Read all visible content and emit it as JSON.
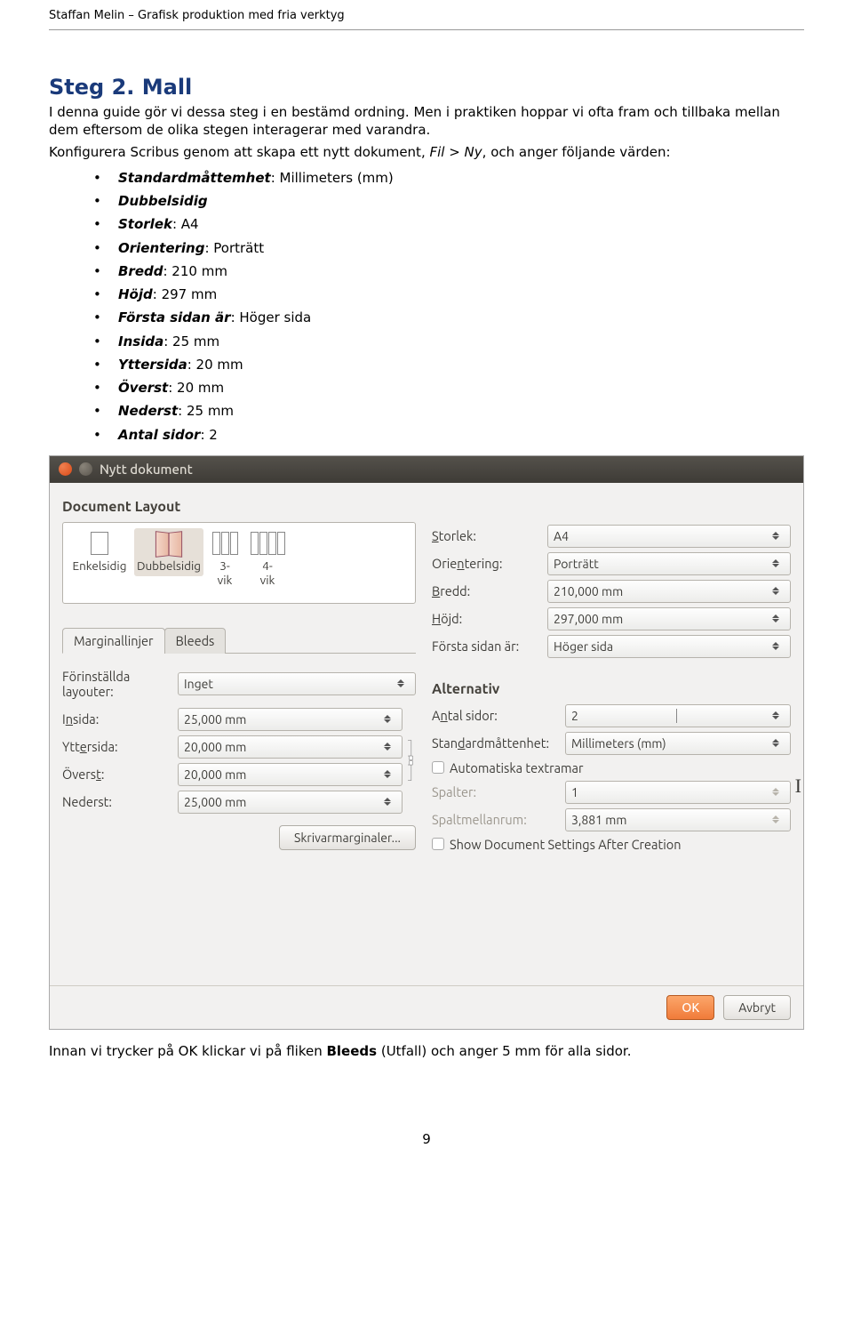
{
  "doc_header": "Staffan Melin – Grafisk produktion med fria verktyg",
  "title": "Steg 2. Mall",
  "para1": "I denna guide gör vi dessa steg i en bestämd ordning. Men i praktiken hoppar vi ofta fram och tillbaka mellan dem eftersom de olika stegen interagerar med varandra.",
  "para2_a": "Konfigurera Scribus genom att skapa ett nytt dokument, ",
  "para2_b": "Fil > Ny",
  "para2_c": ", och anger följande värden:",
  "bullets": [
    {
      "k": "Standardmåttemhet",
      "v": ": Millimeters (mm)"
    },
    {
      "k": "Dubbelsidig",
      "v": ""
    },
    {
      "k": "Storlek",
      "v": ": A4"
    },
    {
      "k": "Orientering",
      "v": ": Porträtt"
    },
    {
      "k": "Bredd",
      "v": ": 210 mm"
    },
    {
      "k": "Höjd",
      "v": ": 297 mm"
    },
    {
      "k": "Första sidan är",
      "v": ": Höger sida"
    },
    {
      "k": "Insida",
      "v": ": 25 mm"
    },
    {
      "k": "Yttersida",
      "v": ": 20 mm"
    },
    {
      "k": "Överst",
      "v": ": 20 mm"
    },
    {
      "k": "Nederst",
      "v": ": 25 mm"
    },
    {
      "k": "Antal sidor",
      "v": ": 2"
    }
  ],
  "dlg": {
    "title": "Nytt dokument",
    "section_layout": "Document Layout",
    "layout_opts": [
      {
        "id": "single",
        "label": "Enkelsidig"
      },
      {
        "id": "double",
        "label": "Dubbelsidig"
      },
      {
        "id": "tri",
        "label": "3-\nvik"
      },
      {
        "id": "quad",
        "label": "4-\nvik"
      }
    ],
    "right": {
      "storlek_l": "Storlek:",
      "storlek_v": "A4",
      "orient_l": "Orientering:",
      "orient_v": "Porträtt",
      "bredd_l": "Bredd:",
      "bredd_v": "210,000 mm",
      "hojd_l": "Höjd:",
      "hojd_v": "297,000 mm",
      "first_l": "Första sidan är:",
      "first_v": "Höger sida"
    },
    "tabs": {
      "margins": "Marginallinjer",
      "bleeds": "Bleeds"
    },
    "margins": {
      "preset_l": "Förinställda layouter:",
      "preset_v": "Inget",
      "inside_l": "Insida:",
      "inside_v": "25,000 mm",
      "outside_l": "Yttersida:",
      "outside_v": "20,000 mm",
      "top_l": "Överst:",
      "top_v": "20,000 mm",
      "bottom_l": "Nederst:",
      "bottom_v": "25,000 mm",
      "printer_btn": "Skrivarmarginaler..."
    },
    "alt": {
      "title": "Alternativ",
      "pages_l": "Antal sidor:",
      "pages_v": "2",
      "unit_l": "Standardmåttenhet:",
      "unit_v": "Millimeters (mm)",
      "auto_l": "Automatiska textramar",
      "cols_l": "Spalter:",
      "cols_v": "1",
      "gap_l": "Spaltmellanrum:",
      "gap_v": "3,881 mm",
      "show_l": "Show Document Settings After Creation"
    },
    "ok": "OK",
    "cancel": "Avbryt"
  },
  "after_a": "Innan vi trycker på OK klickar vi på fliken ",
  "after_b": "Bleeds",
  "after_c": " (Utfall) och anger 5 mm för alla sidor.",
  "page_number": "9"
}
